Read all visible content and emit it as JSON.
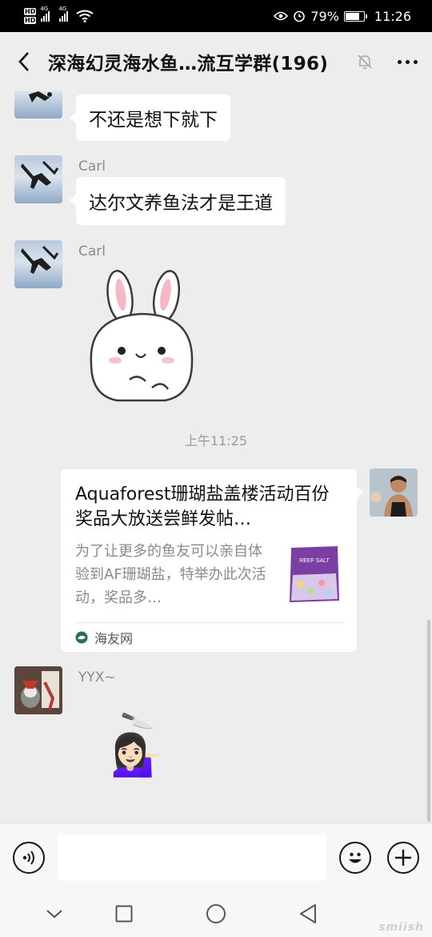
{
  "status_bar": {
    "hd_label": "HD",
    "net_1": "4G",
    "net_2": "4G",
    "battery": "79%",
    "battery_level": 0.79,
    "time": "11:26"
  },
  "header": {
    "title": "深海幻灵海水鱼…流互学群(196)",
    "back_icon": "chevron-left-icon",
    "mute_icon": "bell-muted-icon",
    "more_icon": "more-dots-icon"
  },
  "messages": [
    {
      "sender": "",
      "text": "不还是想下就下"
    },
    {
      "sender": "Carl",
      "text": "达尔文养鱼法才是王道"
    },
    {
      "sender": "Carl",
      "sticker": "white-rabbit-sticker"
    }
  ],
  "timestamp": "上午11:25",
  "link_card": {
    "title": "Aquaforest珊瑚盐盖楼活动百份奖品大放送尝鲜发帖…",
    "description": "为了让更多的鱼友可以亲自体验到AF珊瑚盐，特举办此次活动，奖品多…",
    "source": "海友网",
    "thumb_label": "REEF SALT"
  },
  "last_message": {
    "sender": "YYX~",
    "emoji": "💁🏻‍♀️",
    "prop": "🔪"
  },
  "input_bar": {
    "voice_icon": "voice-icon",
    "emoji_icon": "emoji-icon",
    "plus_icon": "plus-icon",
    "placeholder": ""
  },
  "nav_bar": {
    "icons": [
      "chevron-down-icon",
      "square-icon",
      "circle-icon",
      "triangle-back-icon"
    ]
  },
  "watermark": "smiish"
}
